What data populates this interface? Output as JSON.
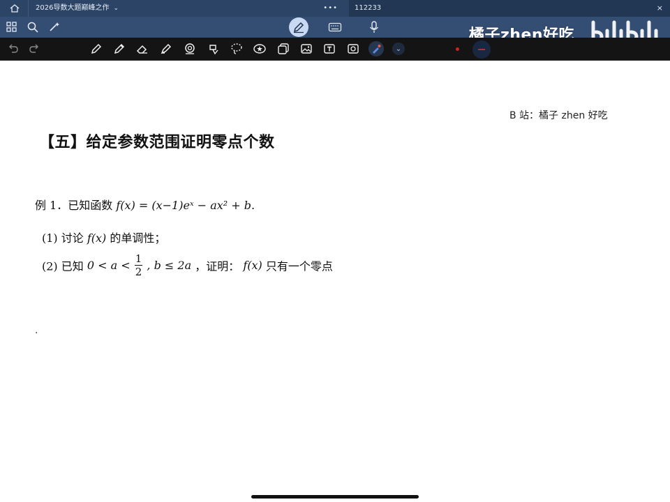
{
  "tabs": [
    {
      "title": "2026导数大题巅峰之作",
      "active": true,
      "menu": "chevron-down"
    },
    {
      "title": "112233",
      "active": false
    }
  ],
  "tab_dots": "•••",
  "tab_close": "×",
  "watermark": "橘子zhen好吃",
  "credit": "B 站：橘子 zhen 好吃",
  "heading": "【五】给定参数范围证明零点个数",
  "example": {
    "label": "例 1．已知函数",
    "function": "f(x) = (x−1)eˣ − ax² + b",
    "end": "."
  },
  "part1": {
    "label": "(1) 讨论",
    "fx": "f(x)",
    "rest": "的单调性；"
  },
  "part2": {
    "label": "(2) 已知",
    "cond_left": "0 < a <",
    "frac_num": "1",
    "frac_den": "2",
    "cond_right": ", b ≤ 2a",
    "prove": "，证明：",
    "fx": "f(x)",
    "rest": "只有一个零点"
  },
  "stray_mark": ".",
  "colors": {
    "tabbar": "#2c4466",
    "navbar": "#344d72",
    "toolbar": "#141414",
    "accent_pen": "#c9d9f2",
    "red_dot": "#d42020"
  }
}
